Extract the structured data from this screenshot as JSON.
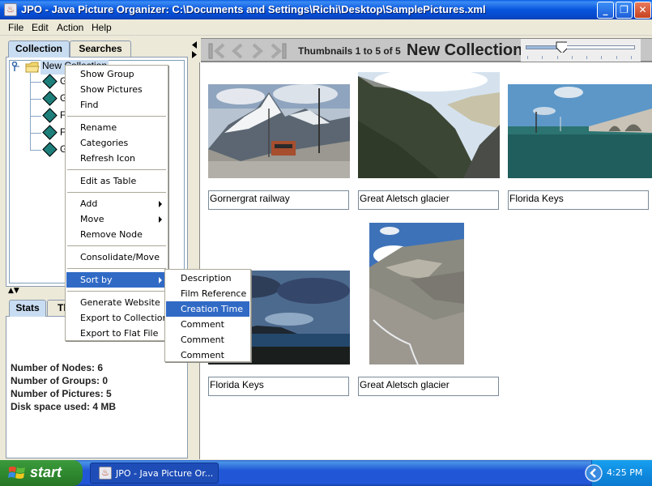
{
  "window": {
    "title": "JPO - Java Picture Organizer:  C:\\Documents and Settings\\Richi\\Desktop\\SamplePictures.xml",
    "app_icon_glyph": "♨",
    "controls": {
      "minimize": "_",
      "restore": "❐",
      "close": "✕"
    }
  },
  "menubar": [
    "File",
    "Edit",
    "Action",
    "Help"
  ],
  "left_panel": {
    "top_tabs": [
      {
        "label": "Collection",
        "active": true
      },
      {
        "label": "Searches",
        "active": false
      }
    ],
    "tree": {
      "root": {
        "label": "New Collection",
        "visible_label": "New Collection",
        "icon": "folder-icon",
        "selected": true
      },
      "children": [
        {
          "label_initial": "G",
          "icon": "film-icon"
        },
        {
          "label_initial": "G",
          "icon": "film-icon"
        },
        {
          "label_initial": "F",
          "icon": "film-icon"
        },
        {
          "label_initial": "F",
          "icon": "film-icon"
        },
        {
          "label_initial": "G",
          "icon": "film-icon"
        }
      ]
    },
    "splitter_arrows": "▲▼",
    "bottom_tabs": [
      {
        "label": "Stats",
        "active": true
      },
      {
        "label": "Th",
        "active": false
      }
    ],
    "stats": [
      "Number of Nodes: 6",
      "Number of Groups: 0",
      "Number of Pictures: 5",
      "Disk space used: 4 MB"
    ]
  },
  "toolbar": {
    "nav": {
      "first": "first-icon",
      "previous": "previous-icon",
      "next": "next-icon",
      "last": "last-icon"
    },
    "thumbnails_label": "Thumbnails 1 to 5 of 5",
    "collection_title": "New Collection",
    "zoom_slider": {
      "value_fraction": 0.33,
      "ticks": 8
    }
  },
  "thumbnails": [
    {
      "caption": "Gornergrat railway",
      "scene": "mountain-railway"
    },
    {
      "caption": "Great Aletsch glacier",
      "scene": "glacier-valley"
    },
    {
      "caption": "Florida Keys",
      "scene": "sea-bridge"
    },
    {
      "caption": "Florida Keys",
      "scene": "dusk-sea"
    },
    {
      "caption": "Great Aletsch glacier",
      "scene": "rocky-gorge"
    }
  ],
  "context_menu": {
    "items": [
      {
        "label": "Show Group"
      },
      {
        "label": "Show Pictures"
      },
      {
        "label": "Find"
      },
      {
        "separator": true
      },
      {
        "label": "Rename"
      },
      {
        "label": "Categories"
      },
      {
        "label": "Refresh Icon"
      },
      {
        "separator": true
      },
      {
        "label": "Edit as Table"
      },
      {
        "separator": true
      },
      {
        "label": "Add",
        "submenu": true
      },
      {
        "label": "Move",
        "submenu": true
      },
      {
        "label": "Remove Node"
      },
      {
        "separator": true
      },
      {
        "label": "Consolidate/Move"
      },
      {
        "separator": true
      },
      {
        "label": "Sort by",
        "submenu": true,
        "highlighted": true
      },
      {
        "separator": true
      },
      {
        "label": "Generate Website"
      },
      {
        "label": "Export to Collection"
      },
      {
        "label": "Export to Flat File"
      }
    ]
  },
  "sort_submenu": {
    "items": [
      {
        "label": "Description"
      },
      {
        "label": "Film Reference"
      },
      {
        "label": "Creation Time",
        "highlighted": true
      },
      {
        "label": "Comment"
      },
      {
        "label": "Comment"
      },
      {
        "label": "Comment"
      }
    ]
  },
  "taskbar": {
    "start_label": "start",
    "task_item": "JPO - Java Picture Or...",
    "clock": "4:25 PM"
  },
  "colors": {
    "highlight": "#316AC5",
    "title_bar": "#0855DD",
    "tab_active": "#C9DDF2",
    "taskbar": "#2157D7",
    "start_green": "#2F8A2F"
  }
}
